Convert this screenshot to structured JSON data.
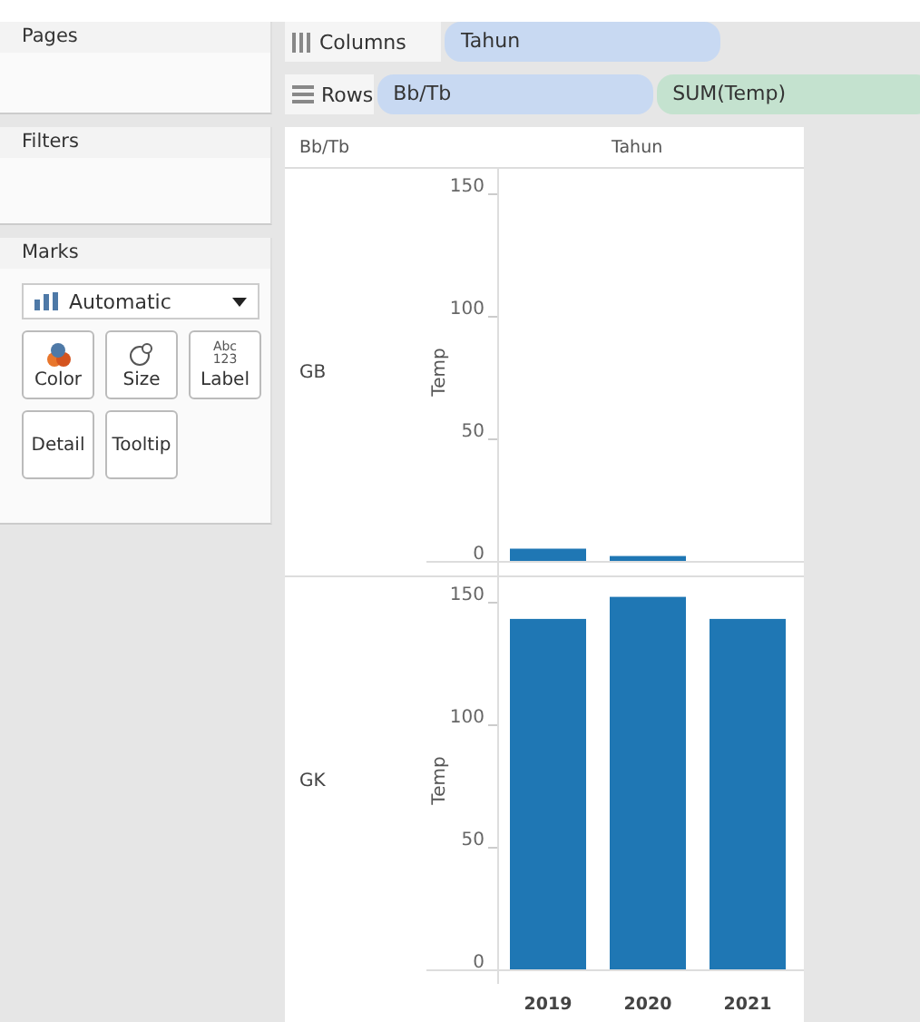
{
  "panels": [
    {
      "title": "Pages"
    },
    {
      "title": "Filters"
    }
  ],
  "marks": {
    "title": "Marks",
    "mark_type": "Automatic",
    "cards": [
      {
        "label": "Color",
        "kind": "color"
      },
      {
        "label": "Size",
        "kind": "size"
      },
      {
        "label": "Label",
        "kind": "label",
        "glyph_lines": [
          "Abc",
          "123"
        ]
      },
      {
        "label": "Detail",
        "kind": "detail"
      },
      {
        "label": "Tooltip",
        "kind": "tooltip"
      }
    ]
  },
  "shelves": [
    {
      "label": "Columns",
      "kind": "columns",
      "pills": [
        {
          "text": "Tahun",
          "kind": "dimension"
        }
      ]
    },
    {
      "label": "Rows",
      "kind": "rows",
      "pills": [
        {
          "text": "Bb/Tb",
          "kind": "dimension"
        },
        {
          "text": "SUM(Temp)",
          "kind": "measure"
        }
      ]
    }
  ],
  "view": {
    "row_header": "Bb/Tb",
    "column_header": "Tahun",
    "panes": [
      {
        "label": "GB",
        "chart_data": {
          "type": "bar",
          "ylabel": "Temp",
          "values": [
            5,
            2,
            null
          ],
          "yticks": [
            0,
            50,
            100,
            150
          ],
          "ylim": [
            0,
            160
          ]
        }
      },
      {
        "label": "GK",
        "chart_data": {
          "type": "bar",
          "ylabel": "Temp",
          "categories": [
            "2019",
            "2020",
            "2021"
          ],
          "values": [
            143,
            152,
            143
          ],
          "yticks": [
            0,
            50,
            100,
            150
          ],
          "ylim": [
            0,
            160
          ]
        }
      }
    ]
  }
}
